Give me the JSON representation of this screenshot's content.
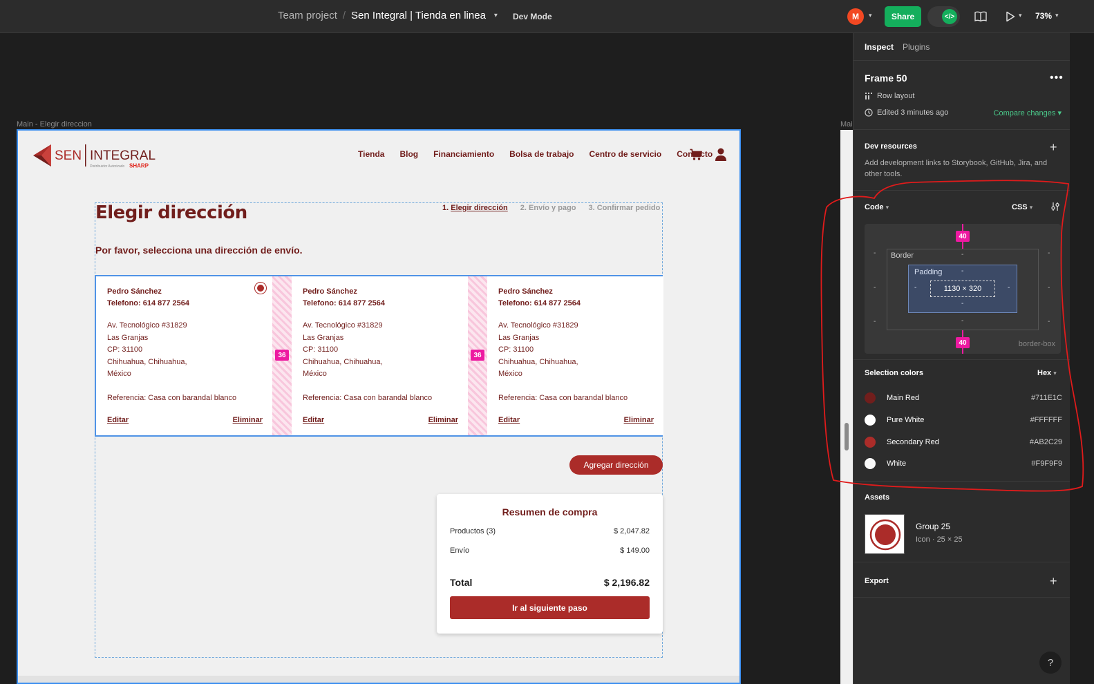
{
  "topbar": {
    "team": "Team project",
    "separator": "/",
    "file_name": "Sen Integral | Tienda en linea",
    "dev_mode_label": "Dev Mode",
    "avatar_letter": "M",
    "share_label": "Share",
    "zoom": "73%"
  },
  "canvas": {
    "frame_label": "Main - Elegir direccion",
    "frame_label_2": "Main",
    "logo": {
      "sen": "SEN",
      "integral": "INTEGRAL",
      "distributor": "Distribuidor Autorizado",
      "sharp": "SHARP"
    },
    "nav": [
      "Tienda",
      "Blog",
      "Financiamiento",
      "Bolsa de trabajo",
      "Centro de servicio",
      "Contacto"
    ],
    "page_title": "Elegir dirección",
    "steps": {
      "step1_num": "1.",
      "step1": "Elegir dirección",
      "step2": "2. Envío y pago",
      "step3": "3. Confirmar pedido"
    },
    "subtitle": "Por favor, selecciona una dirección de envío.",
    "gap_value": "36",
    "addresses": [
      {
        "name": "Pedro Sánchez",
        "phone": "Telefono: 614 877 2564",
        "line1": "Av. Tecnológico #31829",
        "line2": "Las Granjas",
        "line3": "CP: 31100",
        "line4": "Chihuahua, Chihuahua,",
        "line5": "México",
        "reference": "Referencia: Casa con barandal blanco",
        "edit": "Editar",
        "delete": "Eliminar"
      },
      {
        "name": "Pedro Sánchez",
        "phone": "Telefono: 614 877 2564",
        "line1": "Av. Tecnológico #31829",
        "line2": "Las Granjas",
        "line3": "CP: 31100",
        "line4": "Chihuahua, Chihuahua,",
        "line5": "México",
        "reference": "Referencia: Casa con barandal blanco",
        "edit": "Editar",
        "delete": "Eliminar"
      },
      {
        "name": "Pedro Sánchez",
        "phone": "Telefono: 614 877 2564",
        "line1": "Av. Tecnológico #31829",
        "line2": "Las Granjas",
        "line3": "CP: 31100",
        "line4": "Chihuahua, Chihuahua,",
        "line5": "México",
        "reference": "Referencia: Casa con barandal blanco",
        "edit": "Editar",
        "delete": "Eliminar"
      }
    ],
    "add_address": "Agregar dirección",
    "summary": {
      "title": "Resumen de compra",
      "products_label": "Productos (3)",
      "products_value": "$ 2,047.82",
      "shipping_label": "Envío",
      "shipping_value": "$ 149.00",
      "total_label": "Total",
      "total_value": "$ 2,196.82",
      "next_button": "Ir al siguiente paso"
    }
  },
  "panel": {
    "tabs": {
      "inspect": "Inspect",
      "plugins": "Plugins"
    },
    "frame_name": "Frame 50",
    "layout": "Row layout",
    "edited": "Edited 3 minutes ago",
    "compare": "Compare changes",
    "dev_resources_title": "Dev resources",
    "dev_resources_desc": "Add development links to Storybook, GitHub, Jira, and other tools.",
    "code_title": "Code",
    "code_lang": "CSS",
    "box_model": {
      "margin_top": "40",
      "margin_bottom": "40",
      "border_label": "Border",
      "padding_label": "Padding",
      "size": "1130 × 320",
      "dash": "-",
      "box_sizing": "border-box"
    },
    "selection_colors_title": "Selection colors",
    "color_format": "Hex",
    "colors": [
      {
        "name": "Main Red",
        "hex": "#711E1C",
        "swatch": "#711E1C"
      },
      {
        "name": "Pure White",
        "hex": "#FFFFFF",
        "swatch": "#FFFFFF"
      },
      {
        "name": "Secondary Red",
        "hex": "#AB2C29",
        "swatch": "#AB2C29"
      },
      {
        "name": "White",
        "hex": "#F9F9F9",
        "swatch": "#F9F9F9"
      }
    ],
    "assets_title": "Assets",
    "asset_name": "Group 25",
    "asset_meta": "Icon · 25 × 25",
    "export_title": "Export",
    "help": "?"
  }
}
